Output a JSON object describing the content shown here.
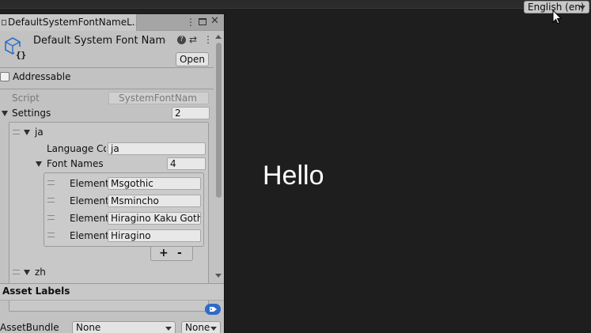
{
  "language_dropdown": {
    "value": "English (en)"
  },
  "game_view": {
    "text": "Hello"
  },
  "inspector": {
    "tab_label": "DefaultSystemFontNameL...",
    "asset_title": "Default System Font Name l",
    "open_label": "Open",
    "addressable_label": "Addressable",
    "script_label": "Script",
    "script_value": "SystemFontNam",
    "settings_label": "Settings",
    "settings_size": "2",
    "element_ja": {
      "label": "ja",
      "language_code_label": "Language Co",
      "language_code_value": "ja",
      "font_names_label": "Font Names",
      "font_names_size": "4",
      "elements": [
        {
          "label": "Element",
          "value": "Msgothic"
        },
        {
          "label": "Element",
          "value": "Msmincho"
        },
        {
          "label": "Element",
          "value": "Hiragino Kaku Gothi"
        },
        {
          "label": "Element",
          "value": "Hiragino"
        }
      ],
      "add_label": "+",
      "remove_label": "-"
    },
    "element_zh": {
      "label": "zh"
    },
    "asset_labels_title": "Asset Labels",
    "asset_bundle_label": "AssetBundle",
    "asset_bundle_value": "None",
    "asset_bundle_variant": "None"
  },
  "icons": [
    "script-asset-icon",
    "help-icon",
    "preset-icon",
    "kebab-menu-icon",
    "maximize-icon",
    "close-icon",
    "tag-icon",
    "mouse-cursor-icon"
  ],
  "colors": {
    "game_bg": "#1e1e1e",
    "inspector_bg": "#c2c2c2",
    "tag_blue": "#2f6bc7",
    "icon_blue": "#2a6fc9"
  }
}
